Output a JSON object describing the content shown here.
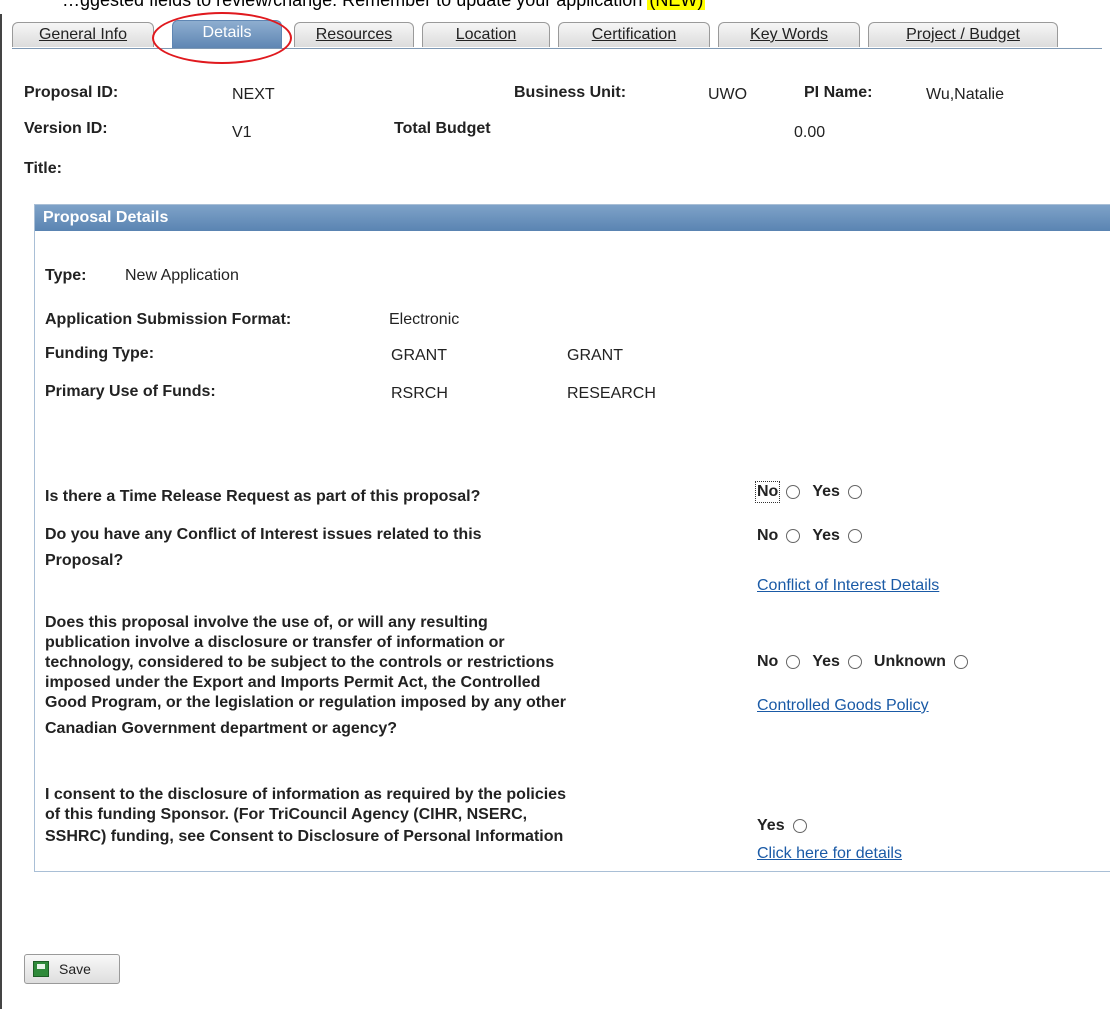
{
  "note": {
    "text": "…ggested fields to review/change. Remember to update your application",
    "highlight": "(NEW)"
  },
  "tabs": [
    {
      "label": "General Info"
    },
    {
      "label": "Details"
    },
    {
      "label": "Resources"
    },
    {
      "label": "Location"
    },
    {
      "label": "Certification"
    },
    {
      "label": "Key Words"
    },
    {
      "label": "Project / Budget"
    }
  ],
  "header": {
    "proposal_id_label": "Proposal ID:",
    "proposal_id": "NEXT",
    "business_unit_label": "Business Unit:",
    "business_unit": "UWO",
    "pi_name_label": "PI Name:",
    "pi_name": "Wu,Natalie",
    "version_id_label": "Version ID:",
    "version_id": "V1",
    "total_budget_label": "Total Budget",
    "total_budget": "0.00",
    "title_label": "Title:"
  },
  "details": {
    "heading": "Proposal Details",
    "type_label": "Type:",
    "type_value": "New Application",
    "format_label": "Application Submission Format:",
    "format_value": "Electronic",
    "funding_type_label": "Funding Type:",
    "funding_type_code": "GRANT",
    "funding_type_desc": "GRANT",
    "use_label": "Primary Use of Funds:",
    "use_code": "RSRCH",
    "use_desc": "RESEARCH"
  },
  "questions": {
    "time_release": "Is there a Time Release Request as part of this proposal?",
    "coi_line1": "Do you have any Conflict of Interest issues related to this",
    "coi_line2": "Proposal?",
    "coi_link": "Conflict of Interest Details",
    "export_line1": "Does this proposal involve the use of, or will any resulting",
    "export_line2": "publication involve a disclosure or transfer of information or",
    "export_line3": "technology, considered to be subject to the controls or restrictions",
    "export_line4": "imposed under the Export and Imports Permit Act, the Controlled",
    "export_line5": "Good Program, or the legislation or regulation imposed by any other",
    "export_line6": "Canadian Government department or agency?",
    "export_link": "Controlled Goods Policy",
    "consent_line1": "I consent to the disclosure of information as required by the policies",
    "consent_line2": "of this funding Sponsor. (For TriCouncil Agency (CIHR, NSERC,",
    "consent_line3": "SSHRC) funding, see Consent to Disclosure of Personal Information",
    "consent_link": "Click here for details"
  },
  "options": {
    "no": "No",
    "yes": "Yes",
    "unknown": "Unknown"
  },
  "save_label": "Save"
}
